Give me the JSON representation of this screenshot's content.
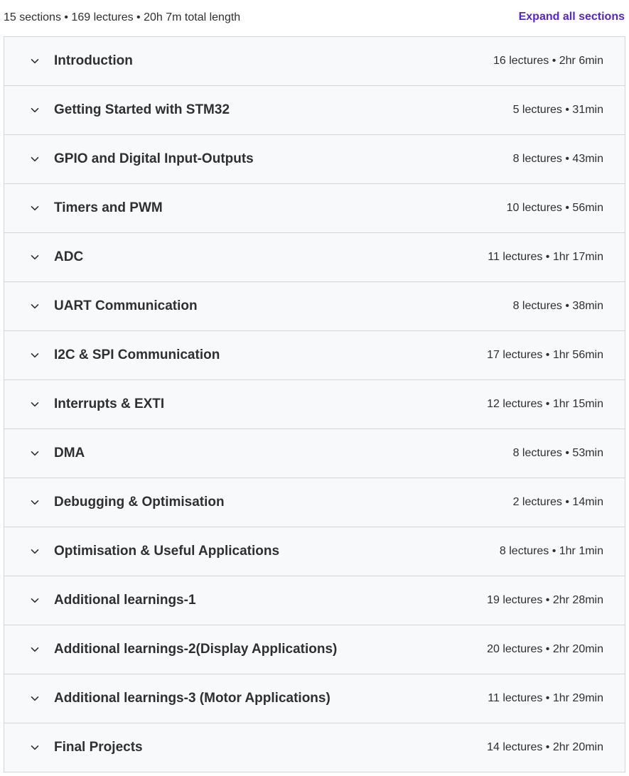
{
  "summary": {
    "text": "15 sections • 169 lectures • 20h 7m total length",
    "expand_label": "Expand all sections"
  },
  "accent_color": "#5624d0",
  "chevron_icon": "chevron-down-icon",
  "sections": [
    {
      "title": "Introduction",
      "meta": "16 lectures • 2hr 6min"
    },
    {
      "title": "Getting Started with STM32",
      "meta": "5 lectures • 31min"
    },
    {
      "title": "GPIO and Digital Input-Outputs",
      "meta": "8 lectures • 43min"
    },
    {
      "title": "Timers and PWM",
      "meta": "10 lectures • 56min"
    },
    {
      "title": "ADC",
      "meta": "11 lectures • 1hr 17min"
    },
    {
      "title": "UART Communication",
      "meta": "8 lectures • 38min"
    },
    {
      "title": "I2C & SPI Communication",
      "meta": "17 lectures • 1hr 56min"
    },
    {
      "title": "Interrupts & EXTI",
      "meta": "12 lectures • 1hr 15min"
    },
    {
      "title": "DMA",
      "meta": "8 lectures • 53min"
    },
    {
      "title": "Debugging & Optimisation",
      "meta": "2 lectures • 14min"
    },
    {
      "title": "Optimisation & Useful Applications",
      "meta": "8 lectures • 1hr 1min"
    },
    {
      "title": "Additional learnings-1",
      "meta": "19 lectures • 2hr 28min"
    },
    {
      "title": "Additional learnings-2(Display Applications)",
      "meta": "20 lectures • 2hr 20min"
    },
    {
      "title": "Additional learnings-3 (Motor Applications)",
      "meta": "11 lectures • 1hr 29min"
    },
    {
      "title": "Final Projects",
      "meta": "14 lectures • 2hr 20min"
    }
  ]
}
